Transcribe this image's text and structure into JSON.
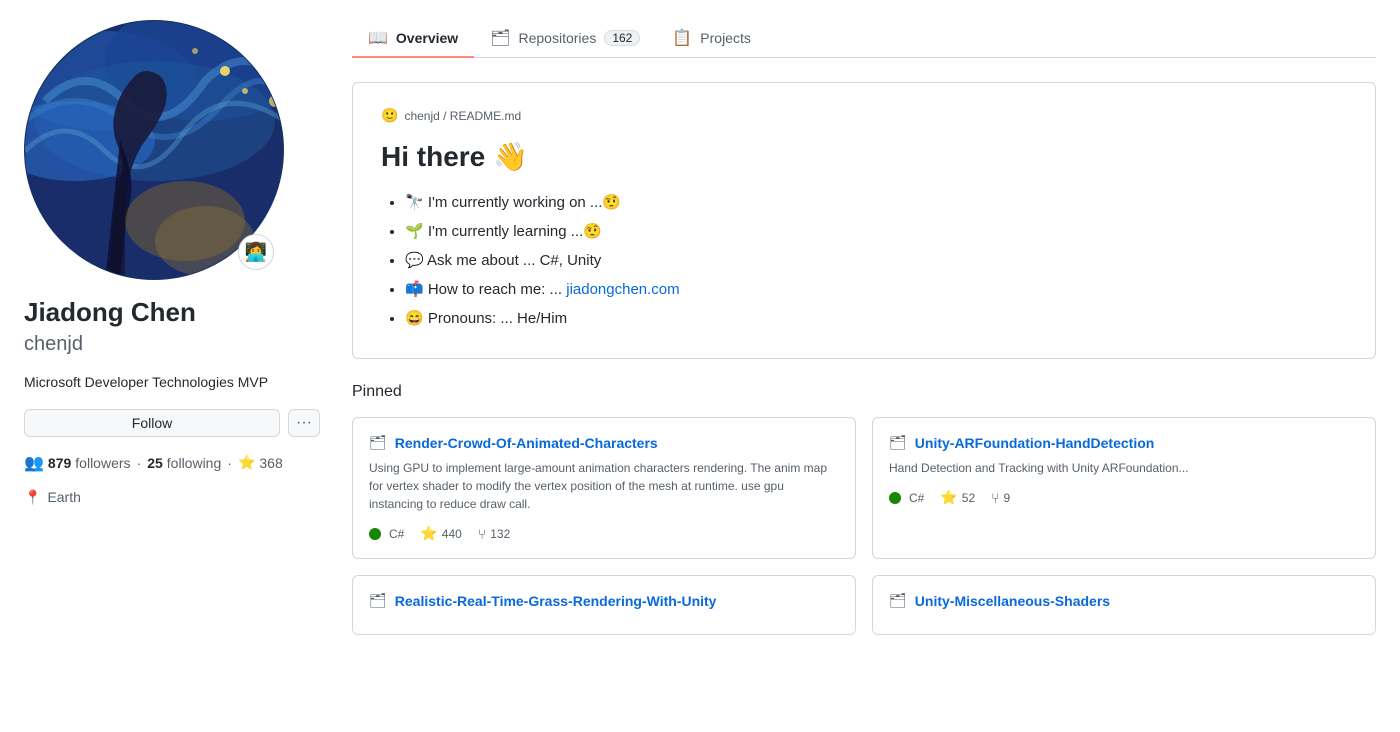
{
  "sidebar": {
    "avatar_badge": "👩‍💻",
    "name": "Jiadong Chen",
    "username": "chenjd",
    "bio": "Microsoft Developer Technologies MVP",
    "follow_label": "Follow",
    "more_label": "···",
    "followers_count": "879",
    "followers_label": "followers",
    "following_count": "25",
    "following_label": "following",
    "stars_count": "368",
    "location": "Earth"
  },
  "tabs": [
    {
      "id": "overview",
      "label": "Overview",
      "icon": "📖",
      "active": true,
      "badge": null
    },
    {
      "id": "repositories",
      "label": "Repositories",
      "icon": "🗂",
      "active": false,
      "badge": "162"
    },
    {
      "id": "projects",
      "label": "Projects",
      "icon": "📋",
      "active": false,
      "badge": null
    }
  ],
  "readme": {
    "header": "chenjd / README.md",
    "title": "Hi there 👋",
    "items": [
      {
        "text": "🔭 I'm currently working on ...🤨"
      },
      {
        "text": "🌱 I'm currently learning ...🤨"
      },
      {
        "text": "💬 Ask me about ... C#, Unity"
      },
      {
        "text": "📫 How to reach me: ... ",
        "link": "jiadongchen.com",
        "href": "https://jiadongchen.com"
      },
      {
        "text": "😄 Pronouns: ... He/Him"
      }
    ]
  },
  "pinned": {
    "section_title": "Pinned",
    "cards": [
      {
        "name": "Render-Crowd-Of-Animated-Characters",
        "desc": "Using GPU to implement large-amount animation characters rendering. The anim map for vertex shader to modify the vertex position of the mesh at runtime. use gpu instancing to reduce draw call.",
        "lang": "C#",
        "stars": "440",
        "forks": "132"
      },
      {
        "name": "Unity-ARFoundation-HandDetection",
        "desc": "Hand Detection and Tracking with Unity ARFoundation...",
        "lang": "C#",
        "stars": "52",
        "forks": "9"
      }
    ],
    "bottom_cards": [
      {
        "name": "Realistic-Real-Time-Grass-Rendering-With-Unity"
      },
      {
        "name": "Unity-Miscellaneous-Shaders"
      }
    ]
  }
}
